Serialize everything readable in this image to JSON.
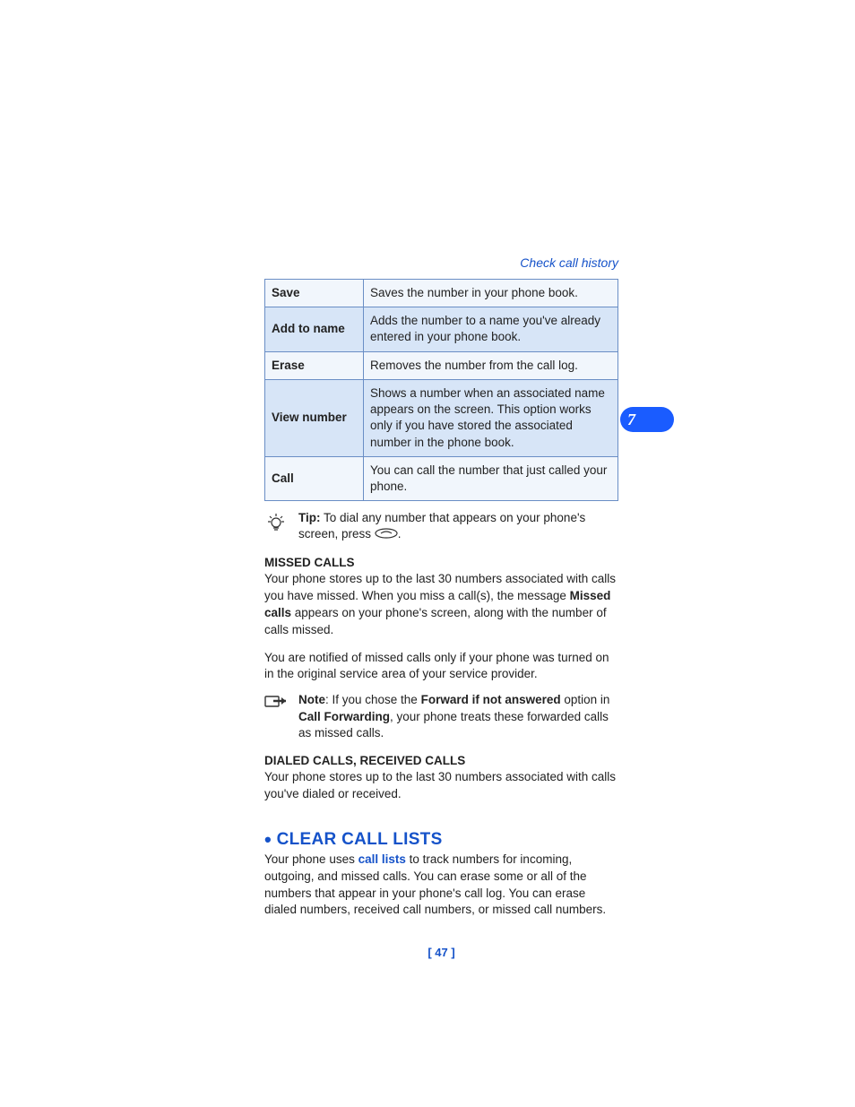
{
  "header": {
    "breadcrumb": "Check call history"
  },
  "table": {
    "rows": [
      {
        "label": "Save",
        "desc": "Saves the number in your phone book."
      },
      {
        "label": "Add to name",
        "desc": "Adds the number to a name you've already entered in your phone book."
      },
      {
        "label": "Erase",
        "desc": "Removes the number from the call log."
      },
      {
        "label": "View number",
        "desc": "Shows a number when an associated name appears on the screen. This option works only if you have stored the associated number in the phone book."
      },
      {
        "label": "Call",
        "desc": "You can call the number that just called your phone."
      }
    ]
  },
  "tip": {
    "label": "Tip:",
    "text_before": " To dial any number that appears on your phone's screen, press ",
    "text_after": "."
  },
  "missed": {
    "heading": "MISSED CALLS",
    "p1_a": "Your phone stores up to the last 30 numbers associated with calls you have missed. When you miss a call(s), the message ",
    "p1_b": "Missed calls",
    "p1_c": " appears on your phone's screen, along with the number of calls missed.",
    "p2": "You are notified of missed calls only if your phone was turned on in the original service area of your service provider."
  },
  "note": {
    "label": "Note",
    "a": ": If you chose the ",
    "b": "Forward if not answered",
    "c": " option in ",
    "d": "Call Forwarding",
    "e": ", your phone treats these forwarded calls as missed calls."
  },
  "dialed": {
    "heading": "DIALED CALLS, RECEIVED CALLS",
    "p": "Your phone stores up to the last 30 numbers associated with calls you've dialed or received."
  },
  "clear": {
    "title": "CLEAR CALL LISTS",
    "p_a": "Your phone uses ",
    "p_link": "call lists",
    "p_b": " to track numbers for incoming, outgoing, and missed calls. You can erase some or all of the numbers that appear in your phone's call log. You can erase dialed numbers, received call numbers, or missed call numbers."
  },
  "tab": {
    "number": "7"
  },
  "footer": {
    "page": "[ 47 ]"
  }
}
